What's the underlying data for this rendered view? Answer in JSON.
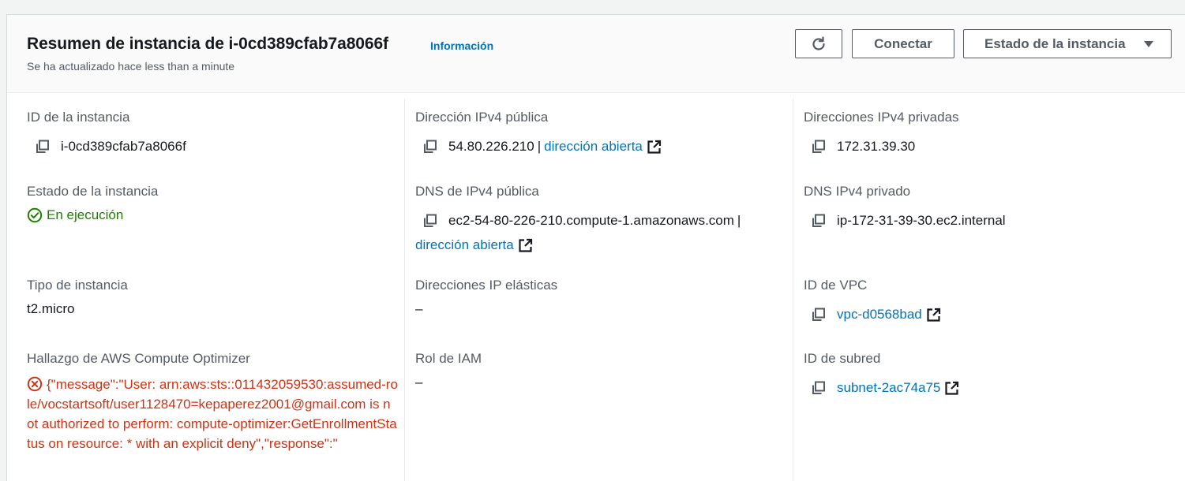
{
  "header": {
    "title": "Resumen de instancia de i-0cd389cfab7a8066f",
    "info_link": "Información",
    "subtitle": "Se ha actualizado hace less than a minute",
    "refresh_icon": "refresh-icon",
    "connect_label": "Conectar",
    "state_label": "Estado de la instancia"
  },
  "col1": {
    "instance_id_label": "ID de la instancia",
    "instance_id_value": "i-0cd389cfab7a8066f",
    "state_label": "Estado de la instancia",
    "state_value": "En ejecución",
    "type_label": "Tipo de instancia",
    "type_value": "t2.micro",
    "optimizer_label": "Hallazgo de AWS Compute Optimizer",
    "optimizer_error": "{\"message\":\"User: arn:aws:sts::011432059530:assumed-role/vocstartsoft/user1128470=kepaperez2001@gmail.com is not authorized to perform: compute-optimizer:GetEnrollmentStatus on resource: * with an explicit deny\",\"response\":\""
  },
  "col2": {
    "public_ipv4_label": "Dirección IPv4 pública",
    "public_ipv4_value": "54.80.226.210",
    "open_address_label": "dirección abierta",
    "public_dns_label": "DNS de IPv4 pública",
    "public_dns_value": "ec2-54-80-226-210.compute-1.amazonaws.com",
    "dns_open_address_label": "dirección abierta",
    "elastic_ip_label": "Direcciones IP elásticas",
    "elastic_ip_value": "–",
    "iam_role_label": "Rol de IAM",
    "iam_role_value": "–"
  },
  "col3": {
    "private_ipv4_label": "Direcciones IPv4 privadas",
    "private_ipv4_value": "172.31.39.30",
    "private_dns_label": "DNS IPv4 privado",
    "private_dns_value": "ip-172-31-39-30.ec2.internal",
    "vpc_label": "ID de VPC",
    "vpc_value": "vpc-d0568bad",
    "subnet_label": "ID de subred",
    "subnet_value": "subnet-2ac74a75"
  },
  "colors": {
    "link": "#0073bb",
    "success": "#1d8102",
    "error": "#d13212",
    "label": "#545b64"
  }
}
